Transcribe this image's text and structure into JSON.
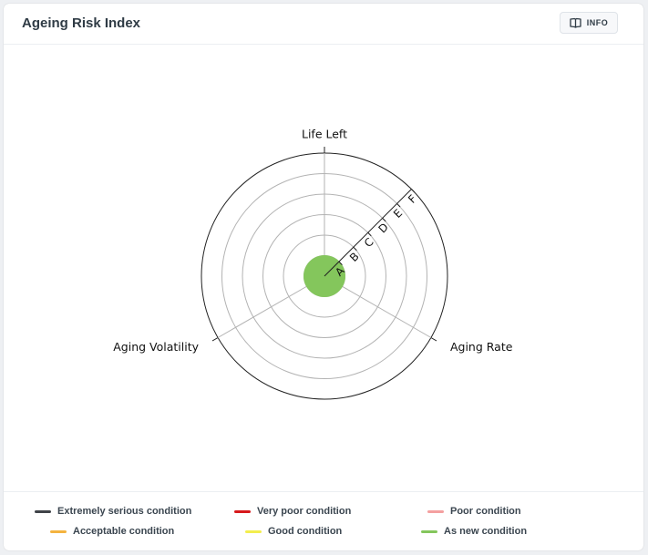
{
  "header": {
    "title": "Ageing Risk Index",
    "info_label": "INFO",
    "info_icon": "book-open-icon"
  },
  "chart_data": {
    "type": "radar",
    "axes": [
      "Life Left",
      "Aging Rate",
      "Aging Volatility"
    ],
    "rings": [
      "A",
      "B",
      "C",
      "D",
      "E",
      "F"
    ],
    "center_color": "#84c65c",
    "series": []
  },
  "legend": [
    {
      "label": "Extremely serious condition",
      "color": "#3f4348"
    },
    {
      "label": "Very poor condition",
      "color": "#d7191c"
    },
    {
      "label": "Poor condition",
      "color": "#f4a0a0"
    },
    {
      "label": "Acceptable condition",
      "color": "#f4b33f"
    },
    {
      "label": "Good condition",
      "color": "#f3ee4e"
    },
    {
      "label": "As new condition",
      "color": "#84c65c"
    }
  ]
}
